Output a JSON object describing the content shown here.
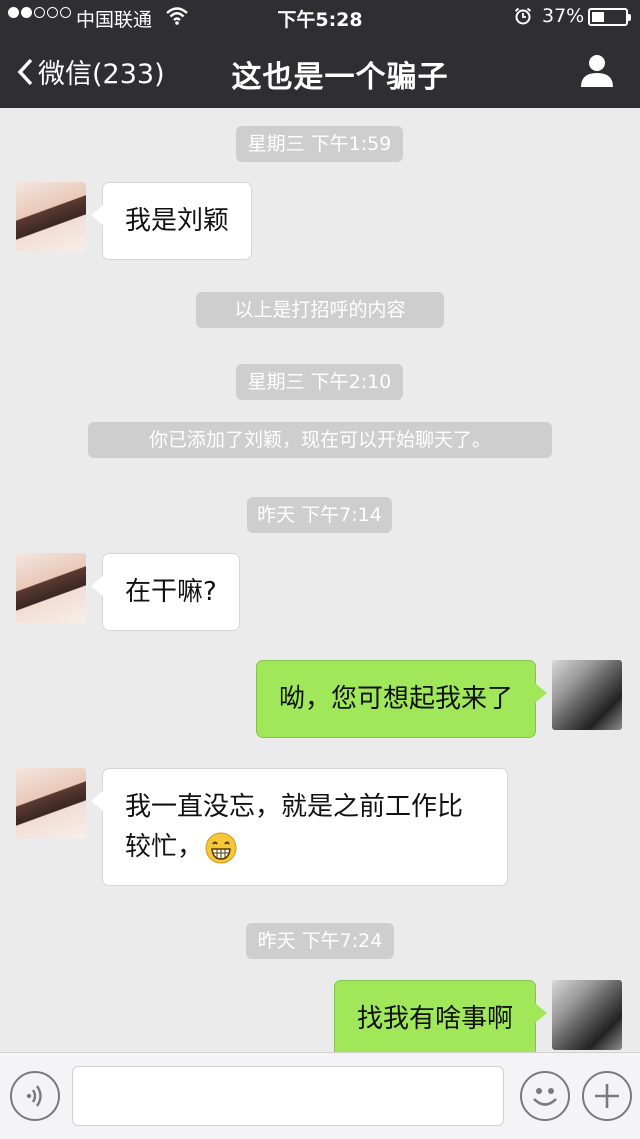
{
  "status_bar": {
    "carrier": "中国联通",
    "time": "下午5:28",
    "battery": "37%",
    "battery_level": 0.37
  },
  "nav": {
    "back_label": "微信(233)",
    "title": "这也是一个骗子"
  },
  "messages": [
    {
      "type": "timestamp",
      "text": "星期三 下午1:59"
    },
    {
      "type": "incoming",
      "text": "我是刘颖"
    },
    {
      "type": "system",
      "text": "以上是打招呼的内容"
    },
    {
      "type": "timestamp",
      "text": "星期三 下午2:10"
    },
    {
      "type": "system",
      "text": "你已添加了刘颖，现在可以开始聊天了。"
    },
    {
      "type": "timestamp",
      "text": "昨天 下午7:14"
    },
    {
      "type": "incoming",
      "text": "在干嘛?"
    },
    {
      "type": "outgoing",
      "text": "呦，您可想起我来了"
    },
    {
      "type": "incoming",
      "text_line1": "我一直没忘，就是之前工作比",
      "text_line2": "较忙，",
      "emoji": "grin-emoji"
    },
    {
      "type": "timestamp",
      "text": "昨天 下午7:24"
    },
    {
      "type": "outgoing",
      "text": "找我有啥事啊"
    }
  ],
  "input_bar": {
    "voice_icon": "voice-icon",
    "emoji_icon": "smiley-icon",
    "plus_icon": "plus-icon",
    "input_value": ""
  },
  "colors": {
    "nav_bg": "#2e2e33",
    "chat_bg": "#ebebeb",
    "outgoing_bubble": "#a0e75a",
    "incoming_bubble": "#ffffff",
    "timestamp_bg": "#cecece"
  }
}
